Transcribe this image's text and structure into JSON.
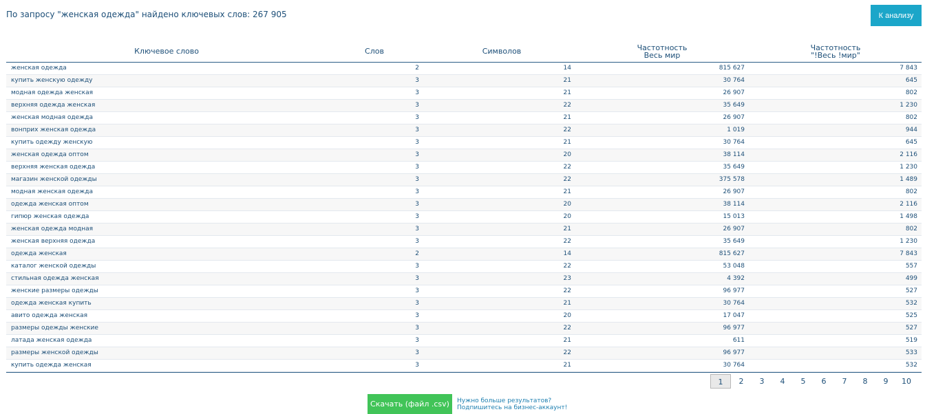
{
  "summary": "По запросу \"женская одежда\" найдено ключевых слов: 267 905",
  "analyze_button": "К анализу",
  "table": {
    "headers": {
      "keyword": "Ключевое слово",
      "words": "Слов",
      "chars": "Символов",
      "freq_world_1": "Частотность",
      "freq_world_2": "Весь мир",
      "freq_exact_1": "Частотность",
      "freq_exact_2": "\"!Весь !мир\""
    },
    "rows": [
      {
        "keyword": "женская одежда",
        "words": "2",
        "chars": "14",
        "freq": "815 627",
        "exact": "7 843"
      },
      {
        "keyword": "купить женскую одежду",
        "words": "3",
        "chars": "21",
        "freq": "30 764",
        "exact": "645"
      },
      {
        "keyword": "модная одежда женская",
        "words": "3",
        "chars": "21",
        "freq": "26 907",
        "exact": "802"
      },
      {
        "keyword": "верхняя одежда женская",
        "words": "3",
        "chars": "22",
        "freq": "35 649",
        "exact": "1 230"
      },
      {
        "keyword": "женская модная одежда",
        "words": "3",
        "chars": "21",
        "freq": "26 907",
        "exact": "802"
      },
      {
        "keyword": "вонприх женская одежда",
        "words": "3",
        "chars": "22",
        "freq": "1 019",
        "exact": "944"
      },
      {
        "keyword": "купить одежду женскую",
        "words": "3",
        "chars": "21",
        "freq": "30 764",
        "exact": "645"
      },
      {
        "keyword": "женская одежда оптом",
        "words": "3",
        "chars": "20",
        "freq": "38 114",
        "exact": "2 116"
      },
      {
        "keyword": "верхняя женская одежда",
        "words": "3",
        "chars": "22",
        "freq": "35 649",
        "exact": "1 230"
      },
      {
        "keyword": "магазин женской одежды",
        "words": "3",
        "chars": "22",
        "freq": "375 578",
        "exact": "1 489"
      },
      {
        "keyword": "модная женская одежда",
        "words": "3",
        "chars": "21",
        "freq": "26 907",
        "exact": "802"
      },
      {
        "keyword": "одежда женская оптом",
        "words": "3",
        "chars": "20",
        "freq": "38 114",
        "exact": "2 116"
      },
      {
        "keyword": "гипюр женская одежда",
        "words": "3",
        "chars": "20",
        "freq": "15 013",
        "exact": "1 498"
      },
      {
        "keyword": "женская одежда модная",
        "words": "3",
        "chars": "21",
        "freq": "26 907",
        "exact": "802"
      },
      {
        "keyword": "женская верхняя одежда",
        "words": "3",
        "chars": "22",
        "freq": "35 649",
        "exact": "1 230"
      },
      {
        "keyword": "одежда женская",
        "words": "2",
        "chars": "14",
        "freq": "815 627",
        "exact": "7 843"
      },
      {
        "keyword": "каталог женской одежды",
        "words": "3",
        "chars": "22",
        "freq": "53 048",
        "exact": "557"
      },
      {
        "keyword": "стильная одежда женская",
        "words": "3",
        "chars": "23",
        "freq": "4 392",
        "exact": "499"
      },
      {
        "keyword": "женские размеры одежды",
        "words": "3",
        "chars": "22",
        "freq": "96 977",
        "exact": "527"
      },
      {
        "keyword": "одежда женская купить",
        "words": "3",
        "chars": "21",
        "freq": "30 764",
        "exact": "532"
      },
      {
        "keyword": "авито одежда женская",
        "words": "3",
        "chars": "20",
        "freq": "17 047",
        "exact": "525"
      },
      {
        "keyword": "размеры одежды женские",
        "words": "3",
        "chars": "22",
        "freq": "96 977",
        "exact": "527"
      },
      {
        "keyword": "латада женская одежда",
        "words": "3",
        "chars": "21",
        "freq": "611",
        "exact": "519"
      },
      {
        "keyword": "размеры женской одежды",
        "words": "3",
        "chars": "22",
        "freq": "96 977",
        "exact": "533"
      },
      {
        "keyword": "купить одежда женская",
        "words": "3",
        "chars": "21",
        "freq": "30 764",
        "exact": "532"
      }
    ]
  },
  "pagination": {
    "current": "1",
    "pages": [
      "1",
      "2",
      "3",
      "4",
      "5",
      "6",
      "7",
      "8",
      "9",
      "10"
    ]
  },
  "download_button": "Скачать (файл .csv)",
  "more_results": {
    "line1": "Нужно больше результатов?",
    "line2": "Подпишитесь на бизнес-аккаунт!"
  },
  "colors": {
    "text": "#1d4f78",
    "analyze_button_bg": "#1ba6c9",
    "download_button_bg": "#41c458",
    "link": "#1d7fb0"
  }
}
